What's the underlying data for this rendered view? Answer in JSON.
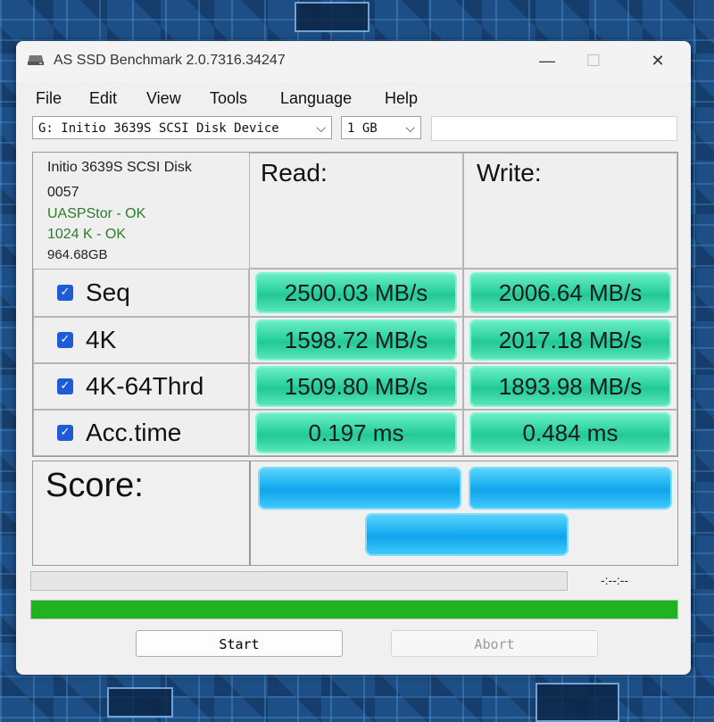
{
  "window": {
    "title": "AS SSD Benchmark 2.0.7316.34247",
    "minimize": "—",
    "maximize": "☐",
    "close": "✕"
  },
  "menu": [
    "File",
    "Edit",
    "View",
    "Tools",
    "Language",
    "Help"
  ],
  "toolbar": {
    "drive_select": "G: Initio 3639S SCSI Disk Device",
    "size_select": "1 GB",
    "textbox_value": ""
  },
  "drive_info": {
    "name": "Initio 3639S SCSI Disk",
    "firmware": "0057",
    "driver_status": "UASPStor - OK",
    "alignment_status": "1024 K - OK",
    "capacity": "964.68GB"
  },
  "columns": {
    "read": "Read:",
    "write": "Write:"
  },
  "tests": [
    {
      "label": "Seq",
      "checked": true,
      "read": "2500.03 MB/s",
      "write": "2006.64 MB/s"
    },
    {
      "label": "4K",
      "checked": true,
      "read": "1598.72 MB/s",
      "write": "2017.18 MB/s"
    },
    {
      "label": "4K-64Thrd",
      "checked": true,
      "read": "1509.80 MB/s",
      "write": "1893.98 MB/s"
    },
    {
      "label": "Acc.time",
      "checked": true,
      "read": "0.197 ms",
      "write": "0.484 ms"
    }
  ],
  "score": {
    "label": "Score:",
    "read": "",
    "write": "",
    "total": ""
  },
  "status": {
    "time": "-:--:--",
    "progress_top": 0,
    "progress_bottom": 100
  },
  "buttons": {
    "start": "Start",
    "abort": "Abort"
  },
  "colors": {
    "result_green": "#2fd3a0",
    "score_blue": "#1aaff0",
    "progress_green": "#1fb41f"
  },
  "icons": {
    "app": "disk-icon",
    "check": "checkbox-checked-icon",
    "chevron": "chevron-down-icon"
  }
}
